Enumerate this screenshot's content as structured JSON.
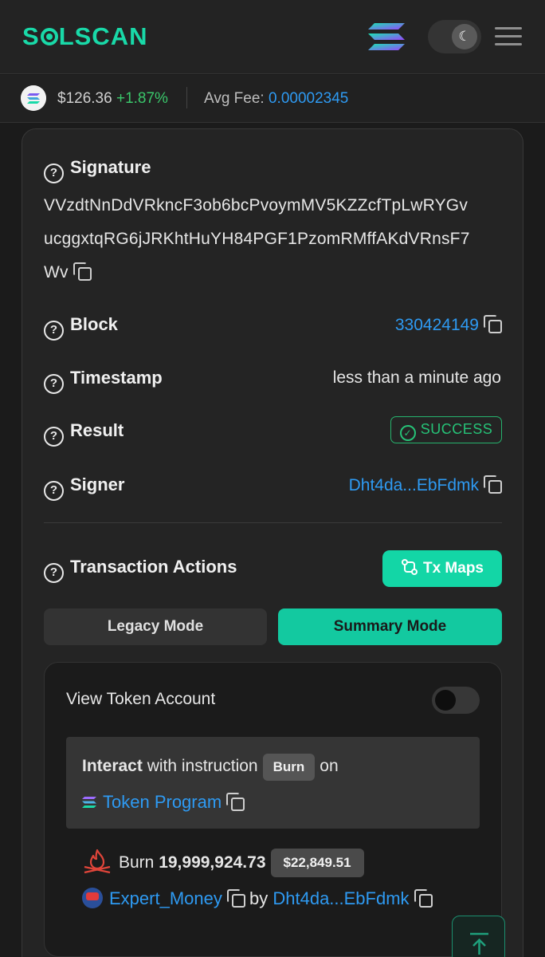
{
  "header": {
    "logo_text_1": "S",
    "logo_text_2": "LSCAN",
    "accent": "#19d9a8",
    "icons": [
      "solana-logo-icon",
      "moon-icon",
      "menu-icon"
    ]
  },
  "pricebar": {
    "price": "$126.36",
    "change": "+1.87%",
    "avg_fee_label": "Avg Fee:",
    "avg_fee_value": "0.00002345"
  },
  "details": {
    "signature_label": "Signature",
    "signature_line1": "VVzdtNnDdVRkncF3ob6bcPvoymMV5KZZcfTpLwRYGv",
    "signature_line2": "ucggxtqRG6jJRKhtHuYH84PGF1PzomRMffAKdVRnsF7",
    "signature_line3": "Wv",
    "block_label": "Block",
    "block_value": "330424149",
    "timestamp_label": "Timestamp",
    "timestamp_value": "less than a minute ago",
    "result_label": "Result",
    "result_value": "SUCCESS",
    "signer_label": "Signer",
    "signer_value": "Dht4da...EbFdmk"
  },
  "actions": {
    "title": "Transaction Actions",
    "tx_maps_label": "Tx Maps",
    "legacy_mode_label": "Legacy Mode",
    "summary_mode_label": "Summary Mode",
    "view_token_account_label": "View Token Account",
    "view_token_account_enabled": false,
    "interact_bold": "Interact",
    "interact_text": "with instruction",
    "instruction_badge": "Burn",
    "on_text": "on",
    "program_name": "Token Program",
    "burn_label": "Burn",
    "burn_amount": "19,999,924.73",
    "burn_usd": "$22,849.51",
    "token_name": "Expert_Money",
    "by_text": "by",
    "burner": "Dht4da...EbFdmk"
  },
  "colors": {
    "link": "#2e9af2",
    "success": "#26c277",
    "positive_change": "#3ac76b"
  }
}
